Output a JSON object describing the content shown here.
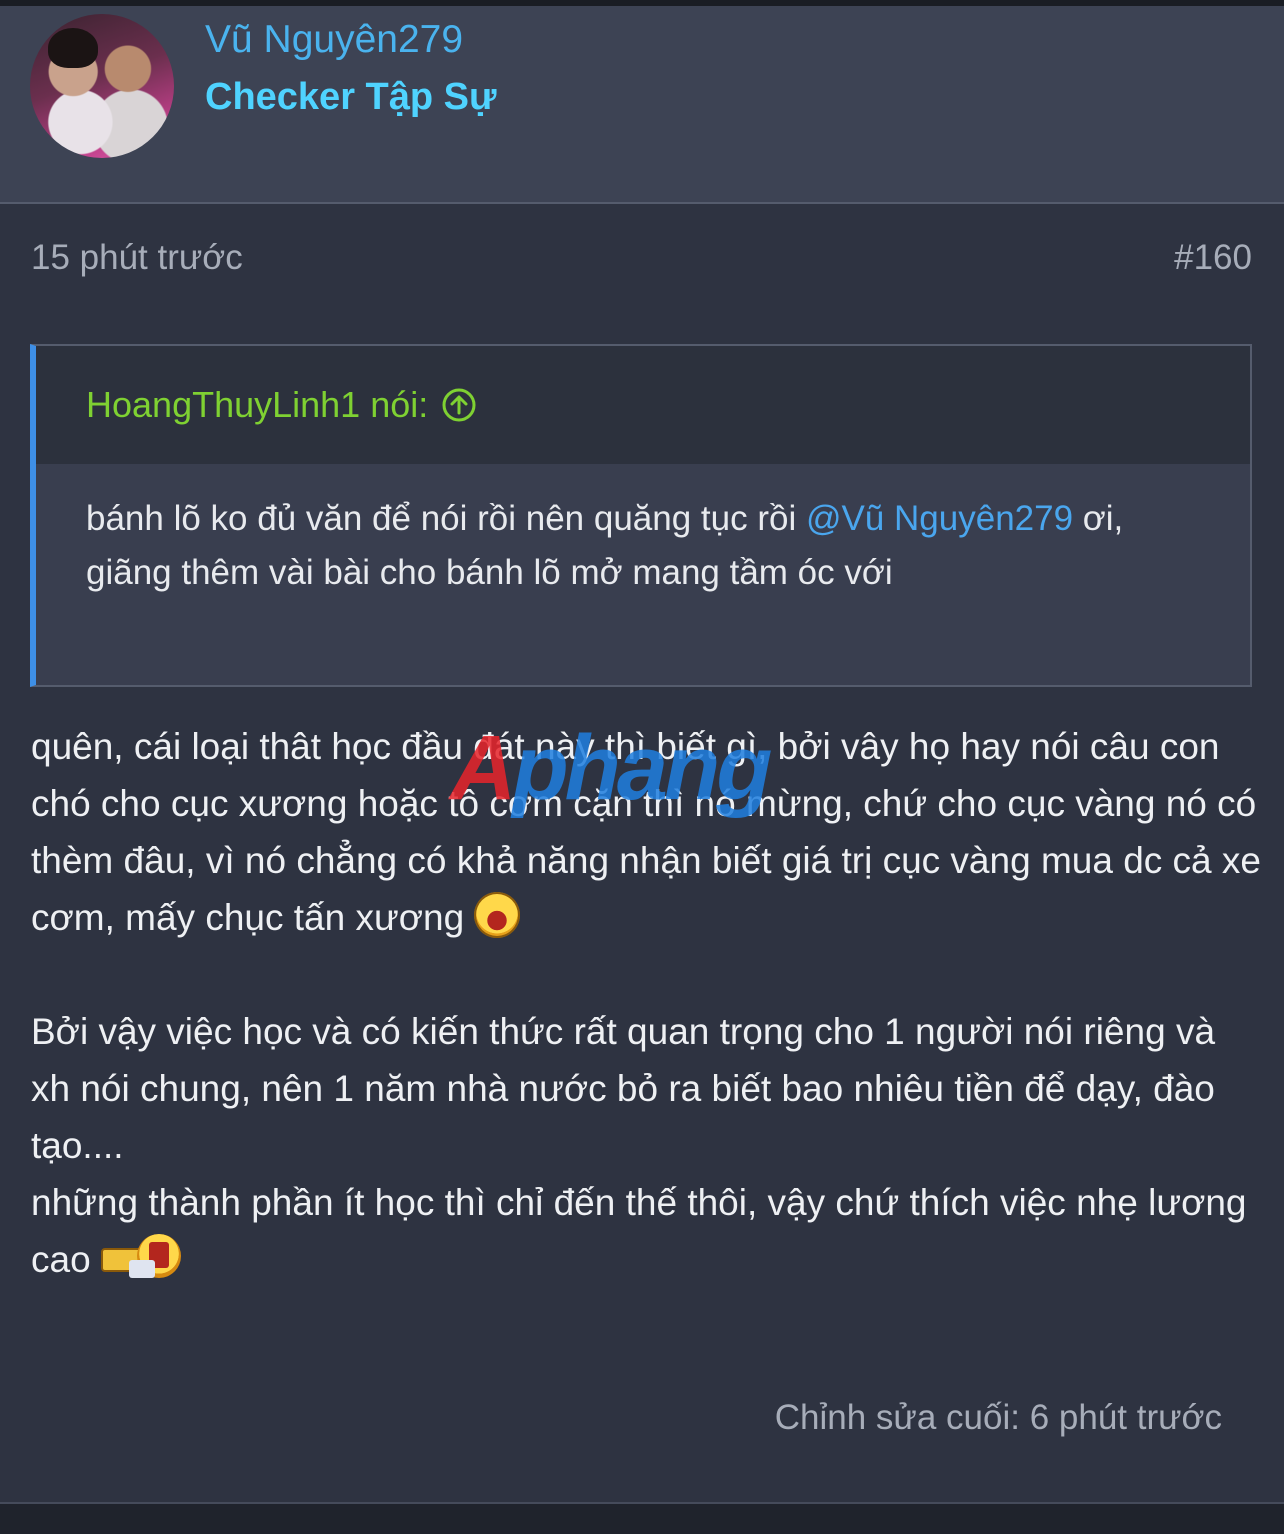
{
  "author": {
    "name": "Vũ Nguyên279",
    "title": "Checker Tập Sự"
  },
  "post": {
    "time": "15 phút trước",
    "number": "#160",
    "quote": {
      "author": "HoangThuyLinh1 nói:",
      "text_before": "bánh lõ ko đủ văn để nói rồi nên quăng tục rồi ",
      "mention": "@Vũ Nguyên279",
      "text_after": " ơi, giãng thêm vài bài cho bánh lõ mở mang tầm óc với"
    },
    "paragraph1": "quên, cái loại thât học đầu đát này thì biết gì, bởi vây họ hay nói câu con chó cho cục xương hoặc tô cơm cặn thì nó mừng, chứ cho cục vàng nó có thèm đâu, vì nó chẳng có khả năng nhận biết giá trị cục vàng mua dc cả xe cơm, mấy chục tấn xương",
    "paragraph2": "Bởi vậy việc học và có kiến thức rất quan trọng cho 1 người nói riêng và xh nói chung, nên 1 năm nhà nước bỏ ra biết bao nhiêu tiền để dạy, đào tạo....",
    "paragraph3": "những thành phần ít học thì chỉ đến thế thôi, vậy chứ thích việc nhẹ lương cao",
    "edited": "Chỉnh sửa cuối: 6 phút trước"
  },
  "watermark": {
    "first": "A",
    "rest": "phang"
  },
  "icons": {
    "quote_jump": "arrow-up-circle-icon",
    "emoji1": "laughing-emoji-icon",
    "emoji2": "money-emoji-icon"
  },
  "colors": {
    "username": "#4ab3ee",
    "usertitle": "#4fd3ff",
    "quote_author": "#7fd132",
    "mention": "#4aa6ee",
    "quote_border": "#3e8fe6"
  }
}
